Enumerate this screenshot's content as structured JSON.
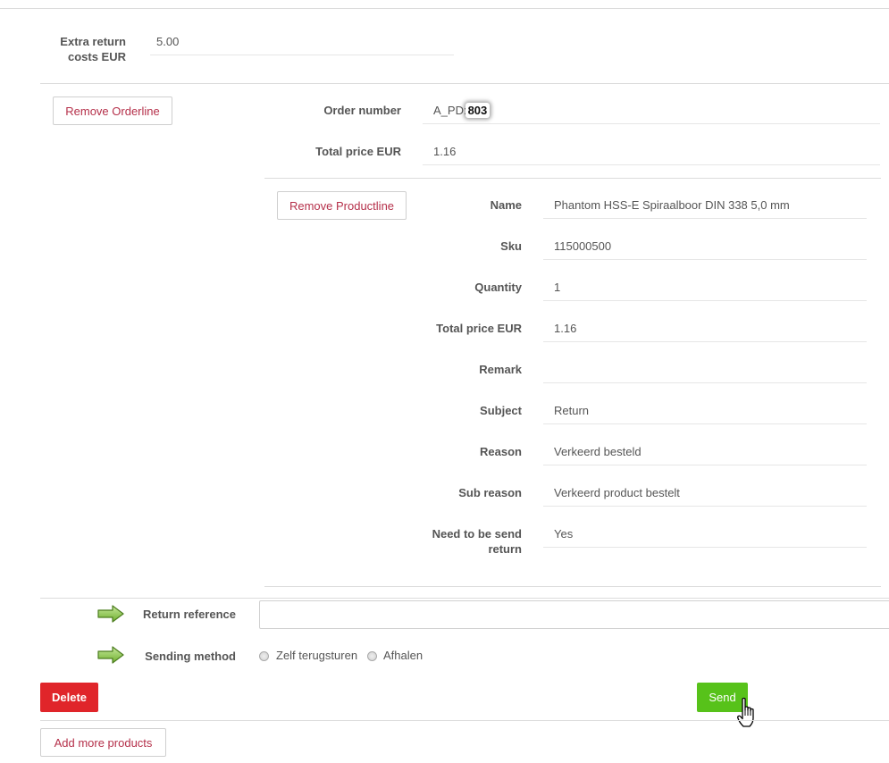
{
  "extra_return": {
    "label": "Extra return costs EUR",
    "label_line1": "Extra return",
    "label_line2": "costs EUR",
    "value": "5.00"
  },
  "orderline": {
    "remove_label": "Remove Orderline",
    "order_number_label": "Order number",
    "order_number_prefix": "A_PD:",
    "order_number_highlight": "803",
    "total_price_label": "Total price EUR",
    "total_price_value": "1.16"
  },
  "productline": {
    "remove_label": "Remove Productline",
    "fields": [
      {
        "label": "Name",
        "value": "Phantom HSS-E Spiraalboor DIN 338 5,0 mm"
      },
      {
        "label": "Sku",
        "value": "115000500"
      },
      {
        "label": "Quantity",
        "value": "1"
      },
      {
        "label": "Total price EUR",
        "value": "1.16"
      },
      {
        "label": "Remark",
        "value": ""
      },
      {
        "label": "Subject",
        "value": "Return"
      },
      {
        "label": "Reason",
        "value": "Verkeerd besteld"
      },
      {
        "label": "Sub reason",
        "value": "Verkeerd product bestelt"
      },
      {
        "label": "Need to be send return",
        "value": "Yes",
        "label_line1": "Need to be send",
        "label_line2": "return"
      }
    ]
  },
  "return_reference": {
    "label": "Return reference",
    "value": ""
  },
  "sending_method": {
    "label": "Sending method",
    "options": [
      {
        "label": "Zelf terugsturen",
        "selected": false
      },
      {
        "label": "Afhalen",
        "selected": false
      }
    ]
  },
  "buttons": {
    "delete": "Delete",
    "send": "Send",
    "add_more": "Add more products"
  },
  "colors": {
    "red": "#e0252a",
    "green": "#57c21a",
    "link": "#b5304a",
    "arrow": "#8bc34a"
  },
  "icons": {
    "arrow": "green-right-arrow-icon",
    "cursor": "hand-pointer-cursor-icon"
  }
}
